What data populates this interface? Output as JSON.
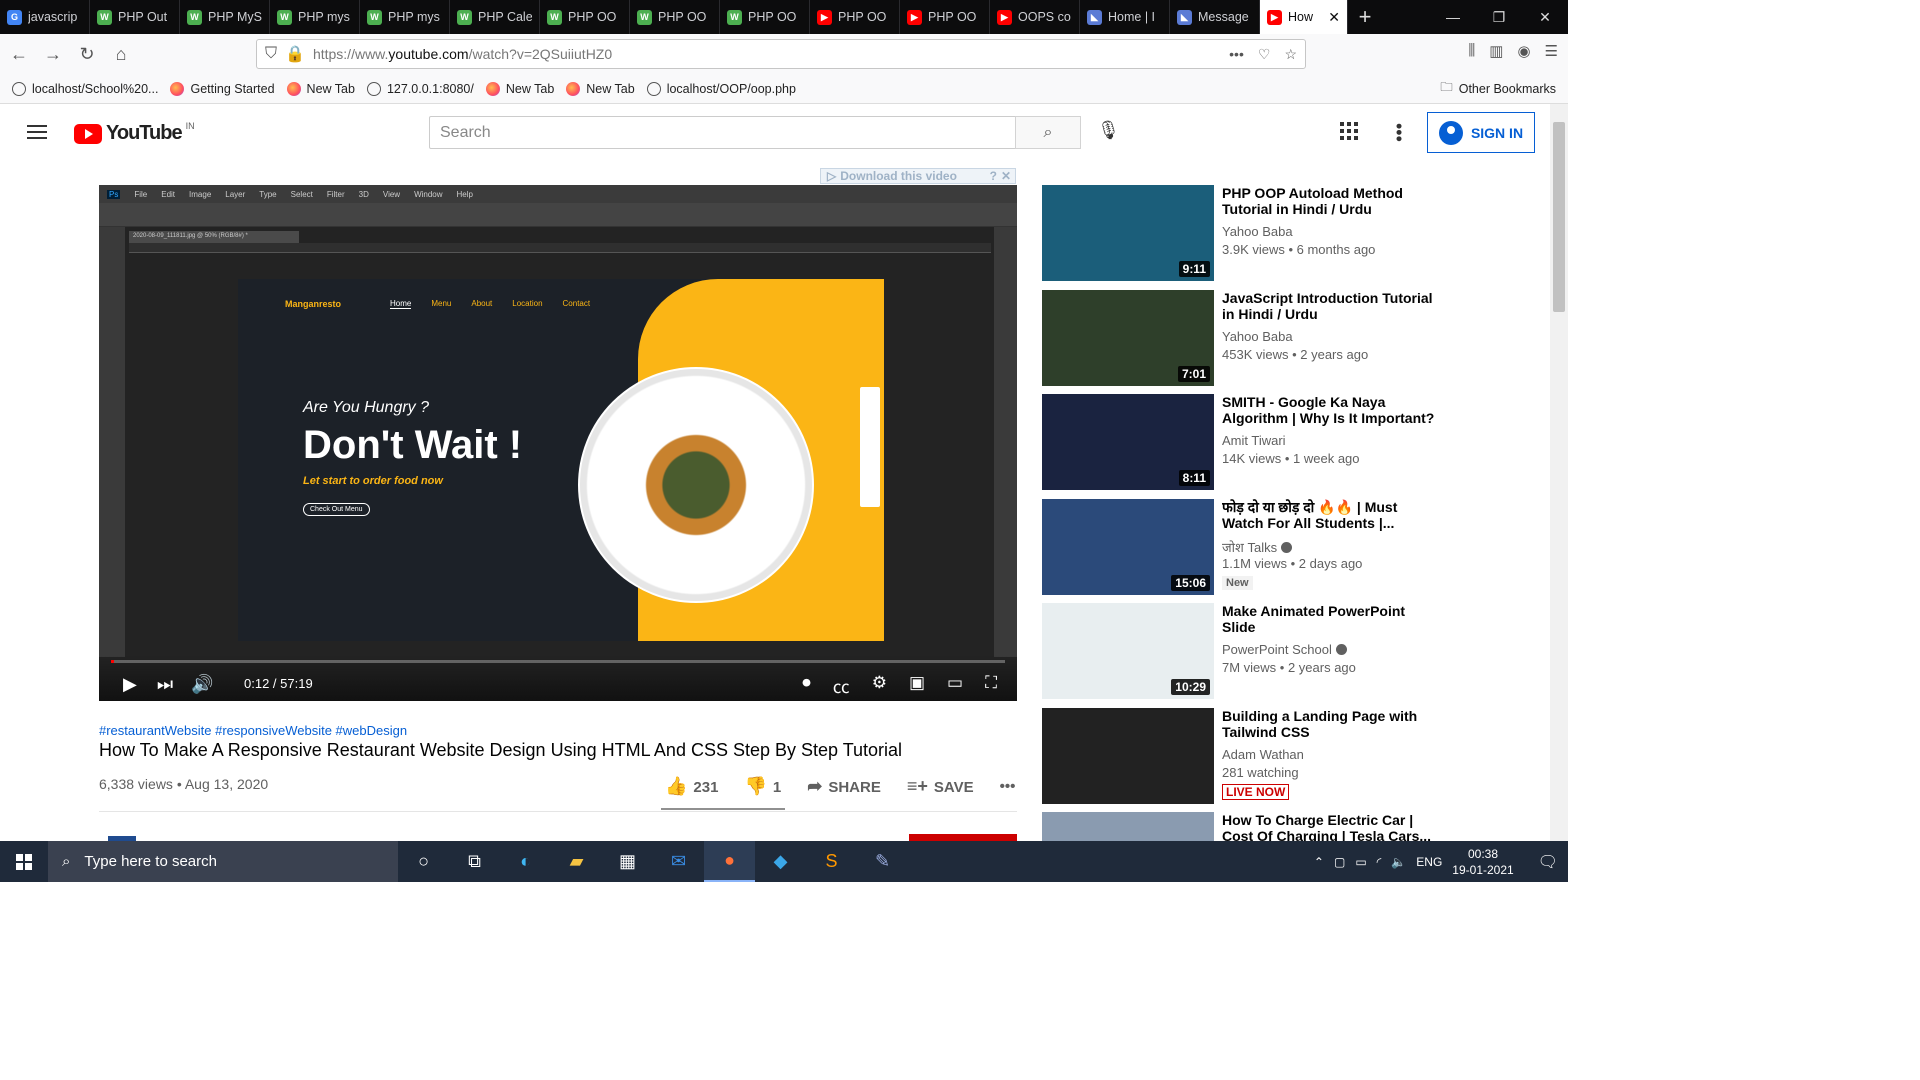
{
  "browser": {
    "tabs": [
      {
        "label": "javascrip",
        "icon": "google-icon",
        "color": "#4285f4"
      },
      {
        "label": "PHP Out",
        "icon": "w3schools-icon",
        "color": "#4caf50"
      },
      {
        "label": "PHP MyS",
        "icon": "w3schools-icon",
        "color": "#4caf50"
      },
      {
        "label": "PHP mys",
        "icon": "w3schools-icon",
        "color": "#4caf50"
      },
      {
        "label": "PHP mys",
        "icon": "w3schools-icon",
        "color": "#4caf50"
      },
      {
        "label": "PHP Cale",
        "icon": "w3schools-icon",
        "color": "#4caf50"
      },
      {
        "label": "PHP OO",
        "icon": "w3schools-icon",
        "color": "#4caf50"
      },
      {
        "label": "PHP OO",
        "icon": "w3schools-icon",
        "color": "#4caf50"
      },
      {
        "label": "PHP OO",
        "icon": "w3schools-icon",
        "color": "#4caf50"
      },
      {
        "label": "PHP OO",
        "icon": "youtube-icon",
        "color": "#ff0000"
      },
      {
        "label": "PHP OO",
        "icon": "youtube-icon",
        "color": "#ff0000"
      },
      {
        "label": "OOPS co",
        "icon": "youtube-icon",
        "color": "#ff0000"
      },
      {
        "label": "Home | I",
        "icon": "messenger-icon",
        "color": "#5b7bd5"
      },
      {
        "label": "Message",
        "icon": "messenger-icon",
        "color": "#5b7bd5"
      }
    ],
    "active_tab": {
      "label": "How",
      "icon": "youtube-icon"
    },
    "url_prefix": "https://www.",
    "url_host": "youtube.com",
    "url_path": "/watch?v=2QSuiiutHZ0",
    "bookmarks": [
      "localhost/School%20...",
      "Getting Started",
      "New Tab",
      "127.0.0.1:8080/",
      "New Tab",
      "New Tab",
      "localhost/OOP/oop.php"
    ],
    "other_bookmarks": "Other Bookmarks"
  },
  "youtube": {
    "logo_text": "YouTube",
    "logo_region": "IN",
    "search_placeholder": "Search",
    "sign_in": "SIGN IN",
    "download_label": "Download this video",
    "player": {
      "time": "0:12 / 57:19",
      "progress_fraction": 0.0035,
      "ps_menu": [
        "File",
        "Edit",
        "Image",
        "Layer",
        "Type",
        "Select",
        "Filter",
        "3D",
        "View",
        "Window",
        "Help"
      ],
      "ps_tab": "2020-08-09_111811.jpg @ 50% (RGB/8#) *",
      "site": {
        "brand": "Manganresto",
        "menu": [
          "Home",
          "Menu",
          "About",
          "Location",
          "Contact"
        ],
        "hungry": "Are You Hungry ?",
        "headline": "Don't Wait !",
        "tagline": "Let start to order food now",
        "cta": "Check Out Menu"
      }
    },
    "video": {
      "hashtags": "#restaurantWebsite #responsiveWebsite #webDesign",
      "title": "How To Make A Responsive Restaurant Website Design Using HTML And CSS Step By Step Tutorial",
      "meta": "6,338 views • Aug 13, 2020",
      "likes": "231",
      "dislikes": "1",
      "share": "SHARE",
      "save": "SAVE"
    },
    "related": [
      {
        "title": "PHP OOP Autoload Method Tutorial in Hindi / Urdu",
        "channel": "Yahoo Baba",
        "views": "3.9K views • 6 months ago",
        "duration": "9:11",
        "bg": "#1b5e7a"
      },
      {
        "title": "JavaScript Introduction Tutorial in Hindi / Urdu",
        "channel": "Yahoo Baba",
        "views": "453K views • 2 years ago",
        "duration": "7:01",
        "bg": "#2e3f2a"
      },
      {
        "title": "SMITH - Google Ka Naya Algorithm | Why Is It Important?",
        "channel": "Amit Tiwari",
        "views": "14K views • 1 week ago",
        "duration": "8:11",
        "bg": "#1a2340"
      },
      {
        "title": "फोड़ दो या छोड़ दो 🔥🔥 | Must Watch For All Students |...",
        "channel": "जोश Talks",
        "views": "1.1M views • 2 days ago",
        "duration": "15:06",
        "bg": "#2b4a7a",
        "badge": "New",
        "verified": true
      },
      {
        "title": "Make Animated PowerPoint Slide",
        "channel": "PowerPoint School",
        "views": "7M views • 2 years ago",
        "duration": "10:29",
        "bg": "#e8eef0",
        "verified": true
      },
      {
        "title": "Building a Landing Page with Tailwind CSS",
        "channel": "Adam Wathan",
        "views": "281 watching",
        "bg": "#222",
        "live": "LIVE NOW"
      },
      {
        "title": "How To Charge Electric Car | Cost Of Charging | Tesla Cars...",
        "channel": "",
        "views": "",
        "bg": "#8a9bb0"
      }
    ]
  },
  "taskbar": {
    "search_placeholder": "Type here to search",
    "lang": "ENG",
    "time": "00:38",
    "date": "19-01-2021"
  }
}
